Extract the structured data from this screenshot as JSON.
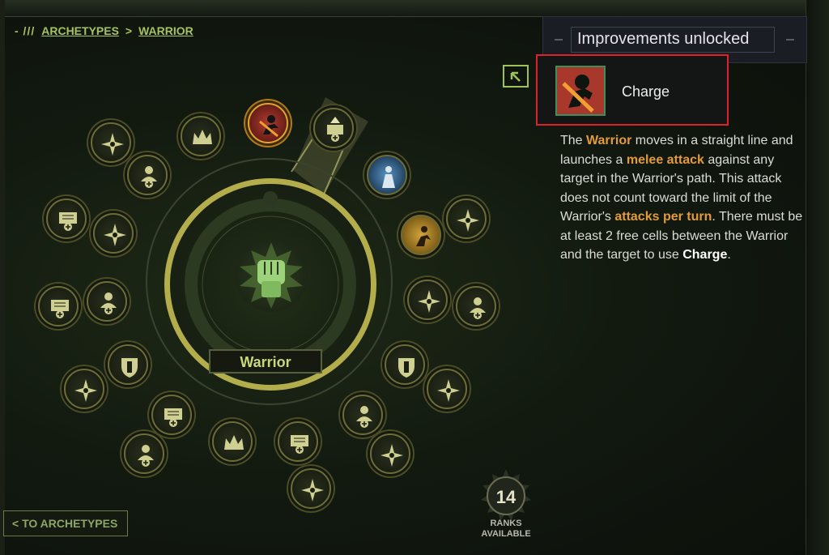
{
  "breadcrumb": {
    "prefix": "- ///",
    "root": "ARCHETYPES",
    "separator": ">",
    "current": "WARRIOR"
  },
  "panel": {
    "header": "Improvements unlocked",
    "selected_skill": "Charge",
    "expand_icon": "arrow-up-left-icon",
    "description": [
      {
        "t": "The ",
        "s": "n"
      },
      {
        "t": "Warrior",
        "s": "hl"
      },
      {
        "t": " moves in a straight line and launches a ",
        "s": "n"
      },
      {
        "t": "melee attack",
        "s": "hl"
      },
      {
        "t": " against any target in the Warrior's path. This attack does not count toward the limit of the Warrior's ",
        "s": "n"
      },
      {
        "t": "attacks per turn",
        "s": "hl"
      },
      {
        "t": ". There must be at least 2 free cells between the Warrior and the target to use ",
        "s": "n"
      },
      {
        "t": "Charge",
        "s": "bw"
      },
      {
        "t": ".",
        "s": "n"
      }
    ]
  },
  "tree": {
    "archetype_name": "Warrior",
    "center_icon": "raised-fist-icon",
    "nodes": [
      {
        "icon": "compass-star-icon",
        "style": "plain"
      },
      {
        "icon": "crown-icon",
        "style": "plain"
      },
      {
        "icon": "charge-icon",
        "style": "red"
      },
      {
        "icon": "shield-upgrade-icon",
        "style": "plain"
      },
      {
        "icon": "soldier-plus-icon",
        "style": "plain"
      },
      {
        "icon": "figure-icon",
        "style": "blue"
      },
      {
        "icon": "book-plus-icon",
        "style": "plain"
      },
      {
        "icon": "compass-star-icon",
        "style": "plain"
      },
      {
        "icon": "runner-icon",
        "style": "gold"
      },
      {
        "icon": "compass-star-icon",
        "style": "plain"
      },
      {
        "icon": "book-plus-icon",
        "style": "plain"
      },
      {
        "icon": "soldier-plus-icon",
        "style": "plain"
      },
      {
        "icon": "compass-star-icon",
        "style": "plain"
      },
      {
        "icon": "soldier-plus-icon",
        "style": "plain"
      },
      {
        "icon": "shield-emblem-icon",
        "style": "plain"
      },
      {
        "icon": "shield-emblem-icon",
        "style": "plain"
      },
      {
        "icon": "compass-star-icon",
        "style": "plain"
      },
      {
        "icon": "book-plus-icon",
        "style": "plain"
      },
      {
        "icon": "compass-star-icon",
        "style": "plain"
      },
      {
        "icon": "soldier-plus-icon",
        "style": "plain"
      },
      {
        "icon": "soldier-plus-icon",
        "style": "plain"
      },
      {
        "icon": "crown-icon",
        "style": "plain"
      },
      {
        "icon": "book-plus-icon",
        "style": "plain"
      },
      {
        "icon": "compass-star-icon",
        "style": "plain"
      },
      {
        "icon": "compass-star-icon",
        "style": "plain"
      }
    ]
  },
  "ranks": {
    "value": "14",
    "label_line1": "RANKS",
    "label_line2": "AVAILABLE"
  },
  "back_button": {
    "label": "< TO ARCHETYPES"
  },
  "colors": {
    "accent": "#a6c35e",
    "highlight": "#e39a3a",
    "selection_border": "#e0202a",
    "ring": "#b3ad4c"
  }
}
